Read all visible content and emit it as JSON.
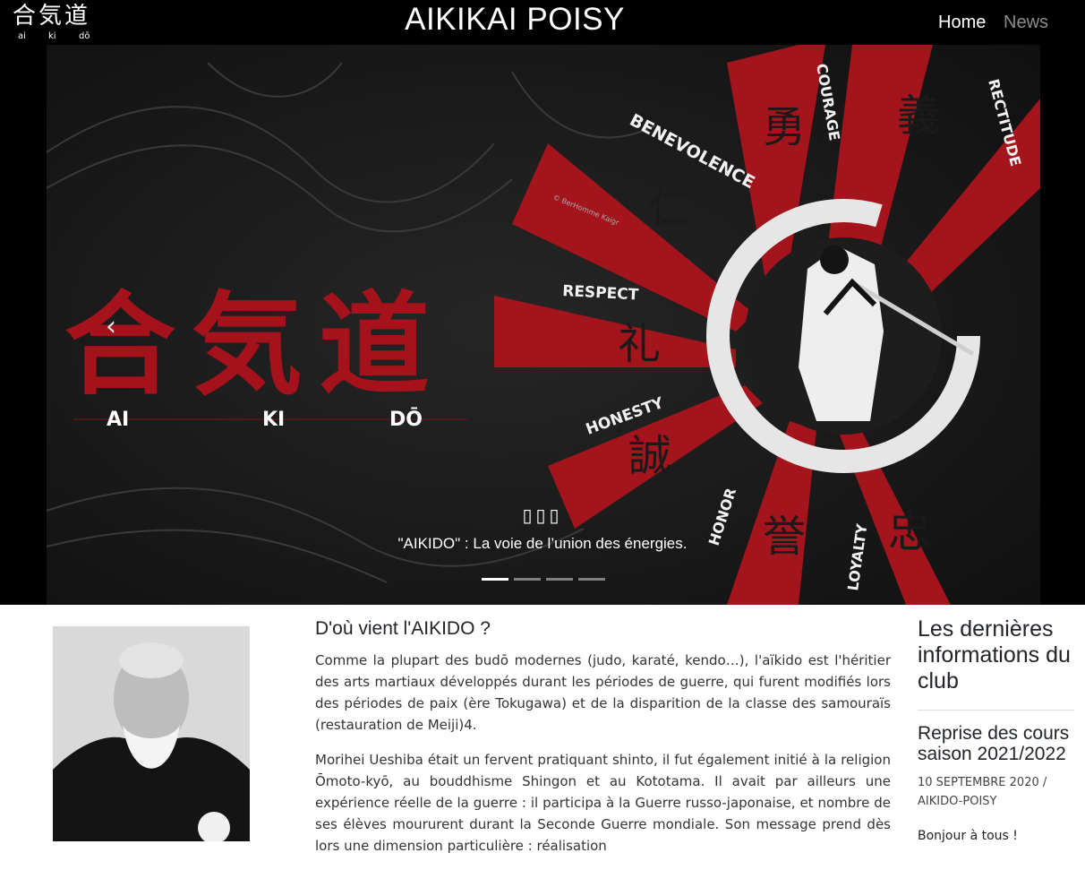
{
  "navbar": {
    "logo_kanji": "合気道",
    "logo_romaji": [
      "ai",
      "ki",
      "dō"
    ],
    "title": "AIKIKAI POISY",
    "links": [
      "Home",
      "News"
    ]
  },
  "carousel": {
    "slide_text": {
      "kanji": "合気道",
      "romaji": [
        "AI",
        "KI",
        "DŌ"
      ],
      "virtues": [
        "BENEVOLENCE",
        "COURAGE",
        "RECTITUDE",
        "RESPECT",
        "HONESTY",
        "HONOR",
        "LOYALTY"
      ],
      "virtue_kanji": [
        "仁",
        "勇",
        "義",
        "礼",
        "誠",
        "誉",
        "忠"
      ],
      "credit": "© BerHomme Kaigr"
    },
    "caption_title": "▯▯▯",
    "caption_text": "\"AIKIDO\" : La voie de l’union des énergies.",
    "slide_count": 4,
    "active_slide": 1,
    "prev_icon": "chevron-left-icon"
  },
  "article": {
    "heading": "D'où vient l'AIKIDO ?",
    "paragraphs": [
      "Comme la plupart des budō modernes (judo, karaté, kendo…), l'aïkido est l'héritier des arts martiaux développés durant les périodes de guerre, qui furent modifiés lors des périodes de paix (ère Tokugawa) et de la disparition de la classe des samouraïs (restauration de Meiji)4.",
      "Morihei Ueshiba était un fervent pratiquant shinto, il fut également initié à la religion Ōmoto-kyō, au bouddhisme Shingon et au Kototama. Il avait par ailleurs une expérience réelle de la guerre : il participa à la Guerre russo-japonaise, et nombre de ses élèves moururent durant la Seconde Guerre mondiale. Son message prend dès lors une dimension particulière : réalisation"
    ]
  },
  "sidebar": {
    "heading": "Les dernières informations du club",
    "post": {
      "title": "Reprise des cours saison 2021/2022",
      "meta": "10 SEPTEMBRE 2020 / AIKIDO-POISY",
      "excerpt": "Bonjour à tous !"
    }
  },
  "colors": {
    "navbar_bg": "#000000",
    "accent_red": "#b3121b",
    "nav_inactive": "#8c8c8c"
  }
}
